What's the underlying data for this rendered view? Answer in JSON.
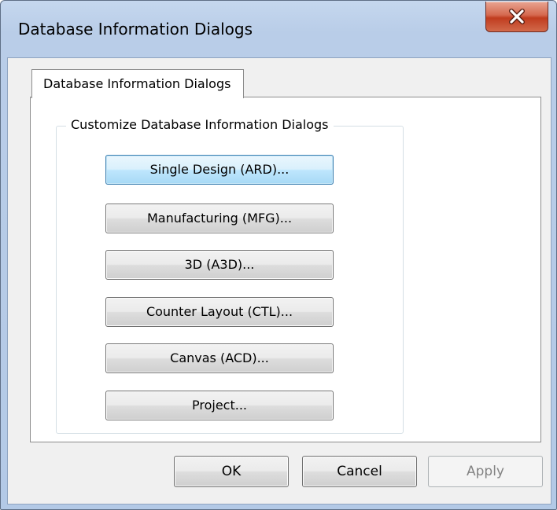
{
  "window": {
    "title": "Database Information Dialogs"
  },
  "tabs": [
    {
      "label": "Database Information Dialogs",
      "selected": true
    }
  ],
  "group": {
    "label": "Customize Database Information Dialogs",
    "buttons": [
      {
        "label": "Single Design (ARD)..."
      },
      {
        "label": "Manufacturing (MFG)..."
      },
      {
        "label": "3D (A3D)..."
      },
      {
        "label": "Counter Layout (CTL)..."
      },
      {
        "label": "Canvas (ACD)..."
      },
      {
        "label": "Project..."
      }
    ]
  },
  "footer": {
    "ok_label": "OK",
    "cancel_label": "Cancel",
    "apply_label": "Apply"
  },
  "icons": {
    "close": "close-icon"
  },
  "colors": {
    "title_bar": "#b9cde8",
    "close_button": "#c9482e",
    "focused_button": "#bee6fd"
  }
}
